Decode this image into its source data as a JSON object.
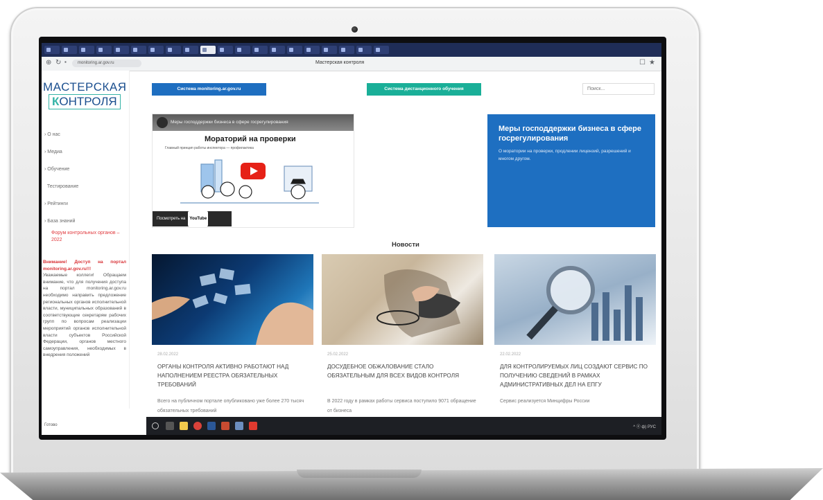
{
  "browser": {
    "page_title": "Мастерская контроля",
    "url": "monitoring.ar.gov.ru",
    "tabs_count": 20,
    "active_tab_index": 9
  },
  "logo": {
    "line1": "МАСТЕРСКАЯ",
    "line2_k": "К",
    "line2_rest": "ОНТРОЛЯ"
  },
  "header": {
    "btn_monitoring": "Система monitoring.ar.gov.ru",
    "btn_distance": "Система дистанционного обучения",
    "search_placeholder": "Поиск..."
  },
  "sidebar": {
    "items": [
      "О нас",
      "Медиа",
      "Обучение",
      "Тестирование",
      "Рейтинги",
      "База знаний"
    ],
    "forum": "Форум контрольных органов – 2022",
    "notice_title": "Внимание! Доступ на портал monitoring.ar.gov.ru!!!",
    "notice_body": "Уважаемые коллеги! Обращаем внимание, что для получения доступа на портал monitoring.ar.gov.ru необходимо направить предложение региональных органов исполнительной власти, муниципальных образований в соответствующие секретарям рабочих групп по вопросам реализации мероприятий органов исполнительной власти субъектов Российской Федерации, органов местного самоуправления, необходимых в внедрения положений"
  },
  "video": {
    "channel_title": "Меры господдержки бизнеса в сфере госрегулирования",
    "slide_title": "Мораторий на проверки",
    "slide_subtitle": "Главный принцип работы инспектора — профилактика",
    "watch_label": "Посмотреть на",
    "yt_label": "YouTube"
  },
  "support": {
    "title": "Меры господдержки бизнеса в сфере госрегулирования",
    "text": "О моратории на проверки, продлении лицензий, разрешений и многом другом."
  },
  "news": {
    "heading": "Новости",
    "cards": [
      {
        "date": "28.02.2022",
        "headline": "Органы контроля активно работают над наполнением реестра обязательных требований",
        "excerpt": "Всего на публичном портале опубликовано уже более 270 тысяч обязательных требований"
      },
      {
        "date": "25.02.2022",
        "headline": "Досудебное обжалование стало обязательным для всех видов контроля",
        "excerpt": "В 2022 году в рамках работы сервиса поступило 9071 обращение от бизнеса"
      },
      {
        "date": "22.02.2022",
        "headline": "Для контролируемых лиц создают сервис по получению сведений в рамках административных дел на ЕПГУ",
        "excerpt": "Сервис реализуется Минцифры России"
      }
    ]
  },
  "taskbar": {
    "time": "^ ⓔ ф) РУС"
  },
  "statusbar": {
    "text": "Готово"
  }
}
